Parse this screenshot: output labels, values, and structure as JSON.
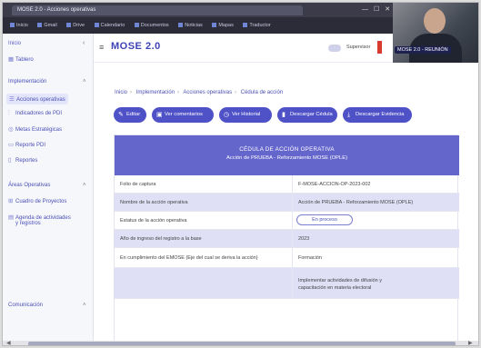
{
  "app": {
    "title": "MOSE 2.0"
  },
  "browser": {
    "tab_title": "MOSE 2.0 - Acciones operativas",
    "bookmarks": [
      "Inicio",
      "Gmail",
      "Drive",
      "Calendario",
      "Documentos",
      "Noticias",
      "Mapas",
      "Traductor"
    ]
  },
  "webcam": {
    "label": "MOSE 2.0 - REUNIÓN"
  },
  "header": {
    "user_name": "Supervisor"
  },
  "sidebar": {
    "home_label": "Inicio",
    "dashboard_label": "Tablero",
    "section_implementacion": "Implementación",
    "items_impl": [
      {
        "label": "Acciones operativas",
        "icon": "list-icon"
      },
      {
        "label": "Indicadores de PDI",
        "icon": "chart-icon"
      },
      {
        "label": "Metas Estratégicas",
        "icon": "target-icon"
      },
      {
        "label": "Reporte PDI",
        "icon": "report-icon"
      },
      {
        "label": "Reportes",
        "icon": "document-icon"
      }
    ],
    "section_areas": "Áreas Operativas",
    "items_areas": [
      {
        "label": "Cuadro de Proyectos",
        "icon": "grid-icon"
      },
      {
        "label": "Agenda de actividades",
        "sublabel": "y registros",
        "icon": "calendar-icon"
      }
    ],
    "section_comunicacion": "Comunicación"
  },
  "breadcrumb": {
    "items": [
      "Inicio",
      "Implementación",
      "Acciones operativas",
      "Cédula de acción"
    ]
  },
  "actions": {
    "edit": "Editar",
    "comments": "Ver comentarios",
    "history": "Ver Historial",
    "download_cedula": "Descargar Cédula",
    "download_evidence": "Descargar Evidencia"
  },
  "card": {
    "title": "CÉDULA DE ACCIÓN OPERATIVA",
    "subtitle": "Acción de PRUEBA - Reforzamiento MOSE (OPLE)",
    "rows": [
      {
        "label": "Folio de captura",
        "value": "F-MOSE-ACCION-OP-2023-002"
      },
      {
        "label": "Nombre de la acción operativa",
        "value": "Acción de PRUEBA - Reforzamiento MOSE (OPLE)"
      },
      {
        "label": "Estatus de la acción operativa",
        "value": "En proceso"
      },
      {
        "label": "Año de ingreso del registro a la base",
        "value": "2023"
      },
      {
        "label": "En cumplimiento del EMOSE (Eje del cual se deriva la acción)",
        "value": "Formación"
      },
      {
        "label": "",
        "value": "Implementar actividades de difusión y capacitación en materia electoral"
      }
    ]
  }
}
